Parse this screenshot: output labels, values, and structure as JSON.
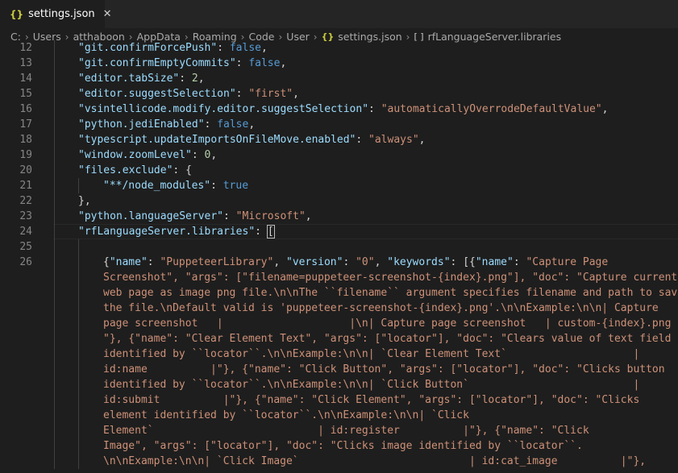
{
  "tab": {
    "icon": "{}",
    "title": "settings.json",
    "close": "✕"
  },
  "breadcrumb": {
    "items": [
      "C:",
      "Users",
      "atthaboon",
      "AppData",
      "Roaming",
      "Code",
      "User"
    ],
    "file_icon": "{}",
    "file": "settings.json",
    "array_icon": "[ ]",
    "symbol": "rfLanguageServer.libraries"
  },
  "editor": {
    "lines": [
      {
        "n": "12",
        "k": "\"git.confirmForcePush\"",
        "v": "false",
        "t": "kw"
      },
      {
        "n": "13",
        "k": "\"git.confirmEmptyCommits\"",
        "v": "false",
        "t": "kw"
      },
      {
        "n": "14",
        "k": "\"editor.tabSize\"",
        "v": "2",
        "t": "num"
      },
      {
        "n": "15",
        "k": "\"editor.suggestSelection\"",
        "v": "\"first\"",
        "t": "str"
      },
      {
        "n": "16",
        "k": "\"vsintellicode.modify.editor.suggestSelection\"",
        "v": "\"automaticallyOverrodeDefaultValue\"",
        "t": "str"
      },
      {
        "n": "17",
        "k": "\"python.jediEnabled\"",
        "v": "false",
        "t": "kw"
      },
      {
        "n": "18",
        "k": "\"typescript.updateImportsOnFileMove.enabled\"",
        "v": "\"always\"",
        "t": "str"
      },
      {
        "n": "19",
        "k": "\"window.zoomLevel\"",
        "v": "0",
        "t": "num"
      },
      {
        "n": "20",
        "k": "\"files.exclude\"",
        "v": "{"
      },
      {
        "n": "21",
        "k": "\"**/node_modules\"",
        "v": "true",
        "t": "kw"
      },
      {
        "n": "22",
        "p": "},"
      },
      {
        "n": "23",
        "k": "\"python.languageServer\"",
        "v": "\"Microsoft\"",
        "t": "str"
      },
      {
        "n": "24",
        "k": "\"rfLanguageServer.libraries\"",
        "v": "["
      },
      {
        "n": "25"
      },
      {
        "n": "26"
      }
    ],
    "wrapped": [
      "Screenshot\", \"args\": [\"filename=puppeteer-screenshot-{index}.png\"], \"doc\": \"Capture current",
      "web page as image png file.\\n\\nThe ``filename`` argument specifies filename and path to save",
      "the file.\\nDefault valid is 'puppeteer-screenshot-{index}.png'.\\n\\nExample:\\n\\n| Capture",
      "page screenshot   |                    |\\n| Capture page screenshot   | custom-{index}.png |",
      "\"}, {\"name\": \"Clear Element Text\", \"args\": [\"locator\"], \"doc\": \"Clears value of text field",
      "identified by ``locator``.\\n\\nExample:\\n\\n| `Clear Element Text`                    |",
      "id:name          |\"}, {\"name\": \"Click Button\", \"args\": [\"locator\"], \"doc\": \"Clicks button",
      "identified by ``locator``.\\n\\nExample:\\n\\n| `Click Button`                          |",
      "id:submit          |\"}, {\"name\": \"Click Element\", \"args\": [\"locator\"], \"doc\": \"Clicks",
      "element identified by ``locator``.\\n\\nExample:\\n\\n| `Click",
      "Element`                          | id:register          |\"}, {\"name\": \"Click",
      "Image\", \"args\": [\"locator\"], \"doc\": \"Clicks image identified by ``locator``.",
      "\\n\\nExample:\\n\\n| `Click Image`                           | id:cat_image          |\"},"
    ],
    "line26": {
      "k1": "\"name\"",
      "v1": "\"PuppeteerLibrary\"",
      "k2": "\"version\"",
      "v2": "\"0\"",
      "k3": "\"keywords\"",
      "open": "[{",
      "k4": "\"name\"",
      "v4": "\"Capture Page"
    }
  }
}
